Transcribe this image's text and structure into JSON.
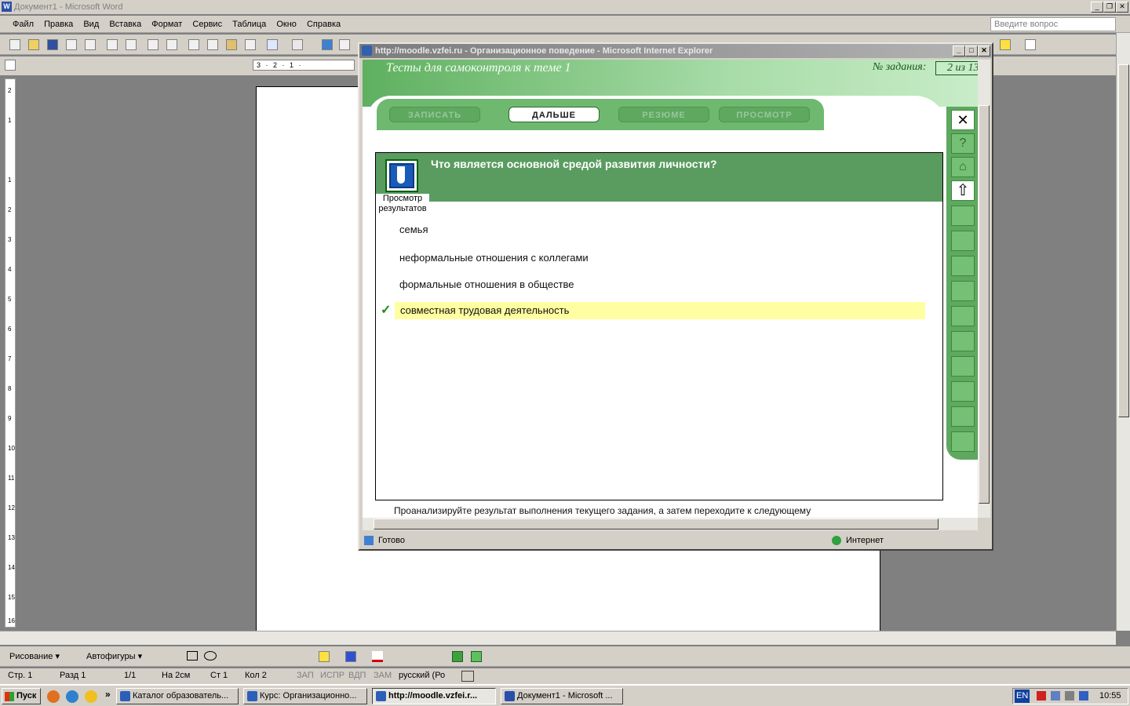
{
  "word": {
    "title": "Документ1 - Microsoft Word",
    "logo_letter": "W",
    "menu": [
      "Файл",
      "Правка",
      "Вид",
      "Вставка",
      "Формат",
      "Сервис",
      "Таблица",
      "Окно",
      "Справка"
    ],
    "ask_placeholder": "Введите вопрос",
    "ruler_text": "3 · 2 · 1 ·",
    "vruler_numbers": [
      "2",
      "1",
      "1",
      "2",
      "3",
      "4",
      "5",
      "6",
      "7",
      "8",
      "9",
      "10",
      "11",
      "12",
      "13",
      "14",
      "15",
      "16"
    ],
    "drawbar": {
      "drawing": "Рисование ▾",
      "autoshapes": "Автофигуры ▾"
    },
    "status": {
      "page": "Стр. 1",
      "section": "Разд 1",
      "pages": "1/1",
      "at": "На 2см",
      "line": "Ст 1",
      "col": "Кол 2",
      "rec": "ЗАП",
      "trk": "ИСПР",
      "ext": "ВДП",
      "ovr": "ЗАМ",
      "lang": "русский (Ро"
    }
  },
  "ie": {
    "title": "http://moodle.vzfei.ru - Организационное поведение - Microsoft Internet Explorer",
    "status_left": "Готово",
    "status_zone": "Интернет"
  },
  "quiz": {
    "header": "Тесты для самоконтроля  к теме 1",
    "task_label": "№ задания:",
    "task_value": "2 из 13",
    "nav": {
      "write": "ЗАПИСАТЬ",
      "next": "ДАЛЬШЕ",
      "resume": "РЕЗЮМЕ",
      "view": "ПРОСМОТР"
    },
    "side": {
      "close": "✕",
      "help": "?",
      "home": "⌂",
      "up": "⇧"
    },
    "question": "Что является основной средой развития личности?",
    "icon_caption": "Просмотр результатов",
    "answers": [
      {
        "text": "семья",
        "selected": false
      },
      {
        "text": "неформальные отношения с коллегами",
        "selected": false
      },
      {
        "text": "формальные отношения в обществе",
        "selected": false
      },
      {
        "text": "совместная трудовая деятельность",
        "selected": true
      }
    ],
    "check_mark": "✓",
    "note": "Проанализируйте результат выполнения текущего задания, а затем переходите к следующему"
  },
  "taskbar": {
    "start": "Пуск",
    "more": "»",
    "tasks": [
      {
        "label": "Каталог образователь...",
        "active": false
      },
      {
        "label": "Курс: Организационно...",
        "active": false
      },
      {
        "label": "http://moodle.vzfei.r...",
        "active": true
      },
      {
        "label": "Документ1 - Microsoft ...",
        "active": false
      }
    ],
    "lang": "EN",
    "clock": "10:55"
  },
  "colors": {
    "accent_green": "#5ea860",
    "highlight": "#fffea0",
    "title_gray": "#7c7c7c"
  }
}
